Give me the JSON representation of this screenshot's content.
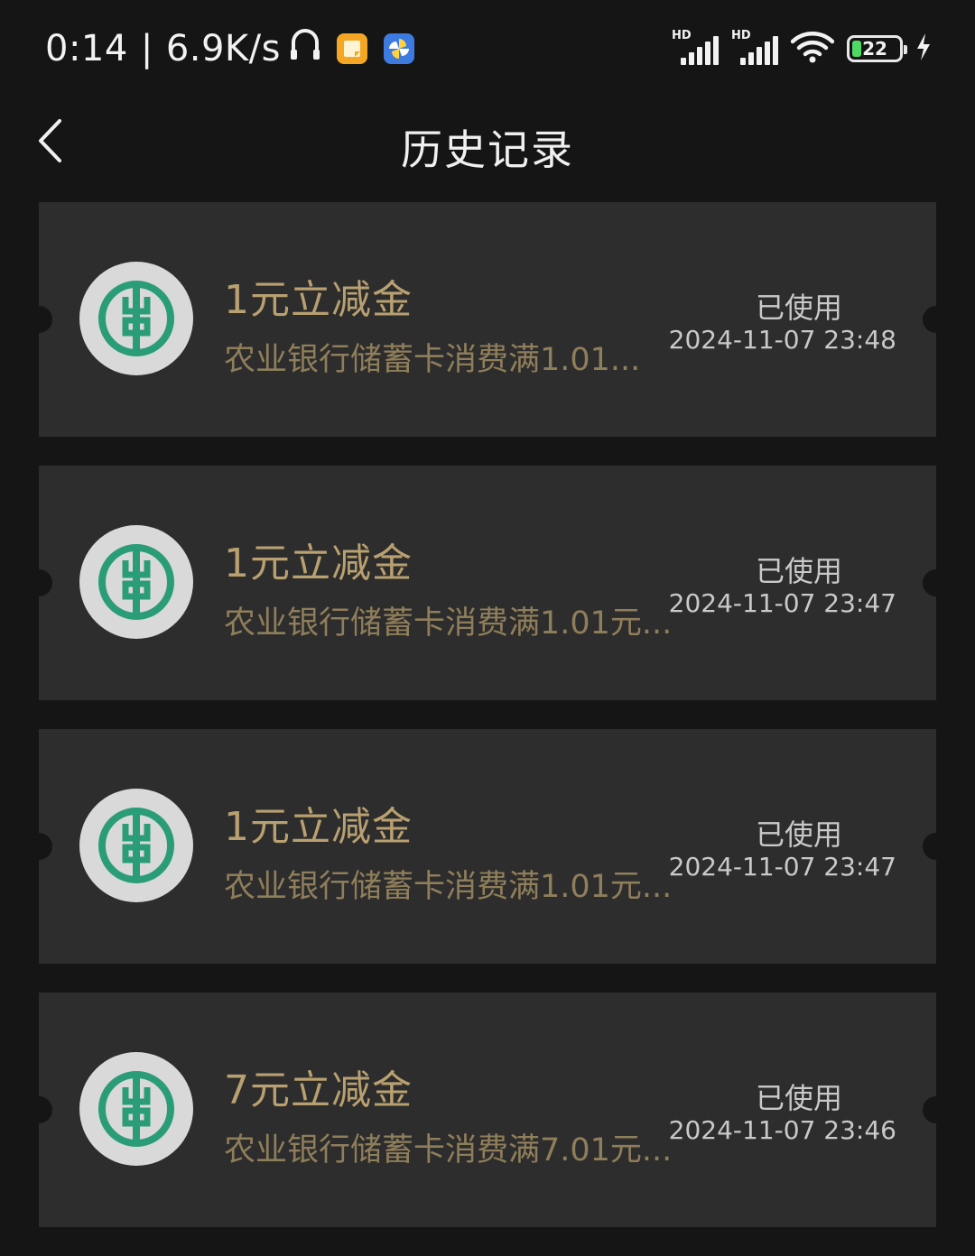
{
  "status_bar": {
    "time": "0:14",
    "separator": "|",
    "net_speed": "6.9K/s",
    "battery_level": "22",
    "icons": [
      "headphones-icon",
      "notes-app-icon",
      "pinwheel-app-icon",
      "signal-hd-icon",
      "signal-hd-icon",
      "wifi-icon",
      "battery-icon",
      "charging-icon"
    ],
    "hd_label": "HD"
  },
  "header": {
    "title": "历史记录",
    "back_icon": "chevron-left-icon"
  },
  "colors": {
    "background": "#151515",
    "card": "#2d2d2d",
    "gold": "#b8a070",
    "gold_dim": "#8f7e5a",
    "logo_green": "#2a9d78",
    "logo_bg": "#d9d9d9",
    "battery_green": "#4cd964"
  },
  "coupons": [
    {
      "title": "1元立减金",
      "description": "农业银行储蓄卡消费满1.01...",
      "status": "已使用",
      "time": "2024-11-07 23:48",
      "logo": "abc-bank-logo-icon"
    },
    {
      "title": "1元立减金",
      "description": "农业银行储蓄卡消费满1.01元...",
      "status": "已使用",
      "time": "2024-11-07 23:47",
      "logo": "abc-bank-logo-icon"
    },
    {
      "title": "1元立减金",
      "description": "农业银行储蓄卡消费满1.01元...",
      "status": "已使用",
      "time": "2024-11-07 23:47",
      "logo": "abc-bank-logo-icon"
    },
    {
      "title": "7元立减金",
      "description": "农业银行储蓄卡消费满7.01元...",
      "status": "已使用",
      "time": "2024-11-07 23:46",
      "logo": "abc-bank-logo-icon"
    }
  ]
}
